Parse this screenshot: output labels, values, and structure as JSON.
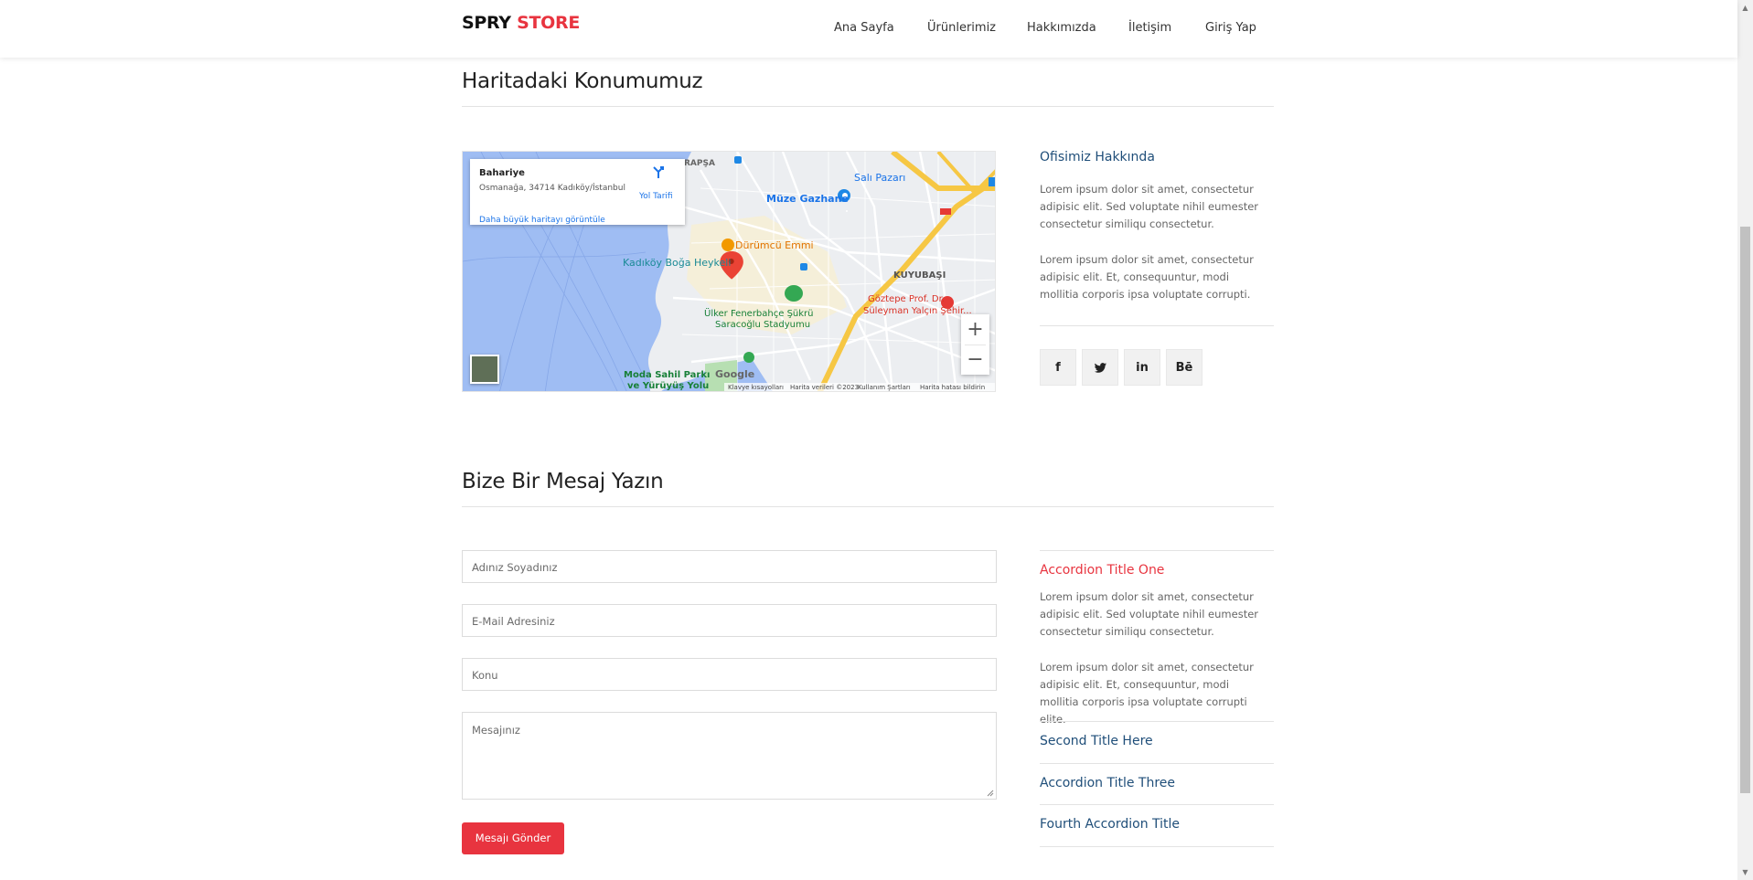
{
  "header": {
    "logo_part1": "SPRY",
    "logo_part2": "STORE",
    "nav": [
      "Ana Sayfa",
      "Ürünlerimiz",
      "Hakkımızda",
      "İletişim",
      "Giriş Yap"
    ]
  },
  "map_section": {
    "title": "Haritadaki Konumumuz",
    "map": {
      "place_name": "Bahariye",
      "address": "Osmanağa, 34714 Kadıköy/İstanbul",
      "bigger_map_link": "Daha büyük haritayı görüntüle",
      "directions_label": "Yol Tarifi",
      "labels": [
        "Müze Gazhane",
        "Salı Pazarı",
        "Dürümcü Emmi",
        "Kadıköy Boğa Heykeli",
        "KUYUBAŞI",
        "Göztepe Prof. Dr. Süleyman Yalçın Şehir...",
        "Ülker Fenerbahçe Şükrü Saracoğlu Stadyumu",
        "Moda Sahil Parkı ve Yürüyüş Yolu",
        "RAPŞA"
      ],
      "zoom_in": "+",
      "zoom_out": "−",
      "footer": [
        "Klavye kısayolları",
        "Harita verileri ©2023",
        "Kullanım Şartları",
        "Harita hatası bildirin"
      ],
      "google": "Google"
    },
    "office": {
      "title": "Ofisimiz Hakkında",
      "paragraph1": "Lorem ipsum dolor sit amet, consectetur adipisic elit. Sed voluptate nihil eumester consectetur similiqu consectetur.",
      "paragraph2": "Lorem ipsum dolor sit amet, consectetur adipisic elit. Et, consequuntur, modi mollitia corporis ipsa voluptate corrupti."
    },
    "social": [
      "f",
      "t",
      "in",
      "Bē"
    ]
  },
  "contact_section": {
    "title": "Bize Bir Mesaj Yazın",
    "form": {
      "name_placeholder": "Adınız Soyadınız",
      "email_placeholder": "E-Mail Adresiniz",
      "subject_placeholder": "Konu",
      "message_placeholder": "Mesajınız",
      "submit_label": "Mesajı Gönder"
    },
    "accordion": [
      {
        "title": "Accordion Title One",
        "paragraph1": "Lorem ipsum dolor sit amet, consectetur adipisic elit. Sed voluptate nihil eumester consectetur similiqu consectetur.",
        "paragraph2": "Lorem ipsum dolor sit amet, consectetur adipisic elit. Et, consequuntur, modi mollitia corporis ipsa voluptate corrupti elite."
      },
      {
        "title": "Second Title Here"
      },
      {
        "title": "Accordion Title Three"
      },
      {
        "title": "Fourth Accordion Title"
      }
    ]
  },
  "colors": {
    "accent": "#e8343f",
    "link_blue": "#1f4e79"
  }
}
